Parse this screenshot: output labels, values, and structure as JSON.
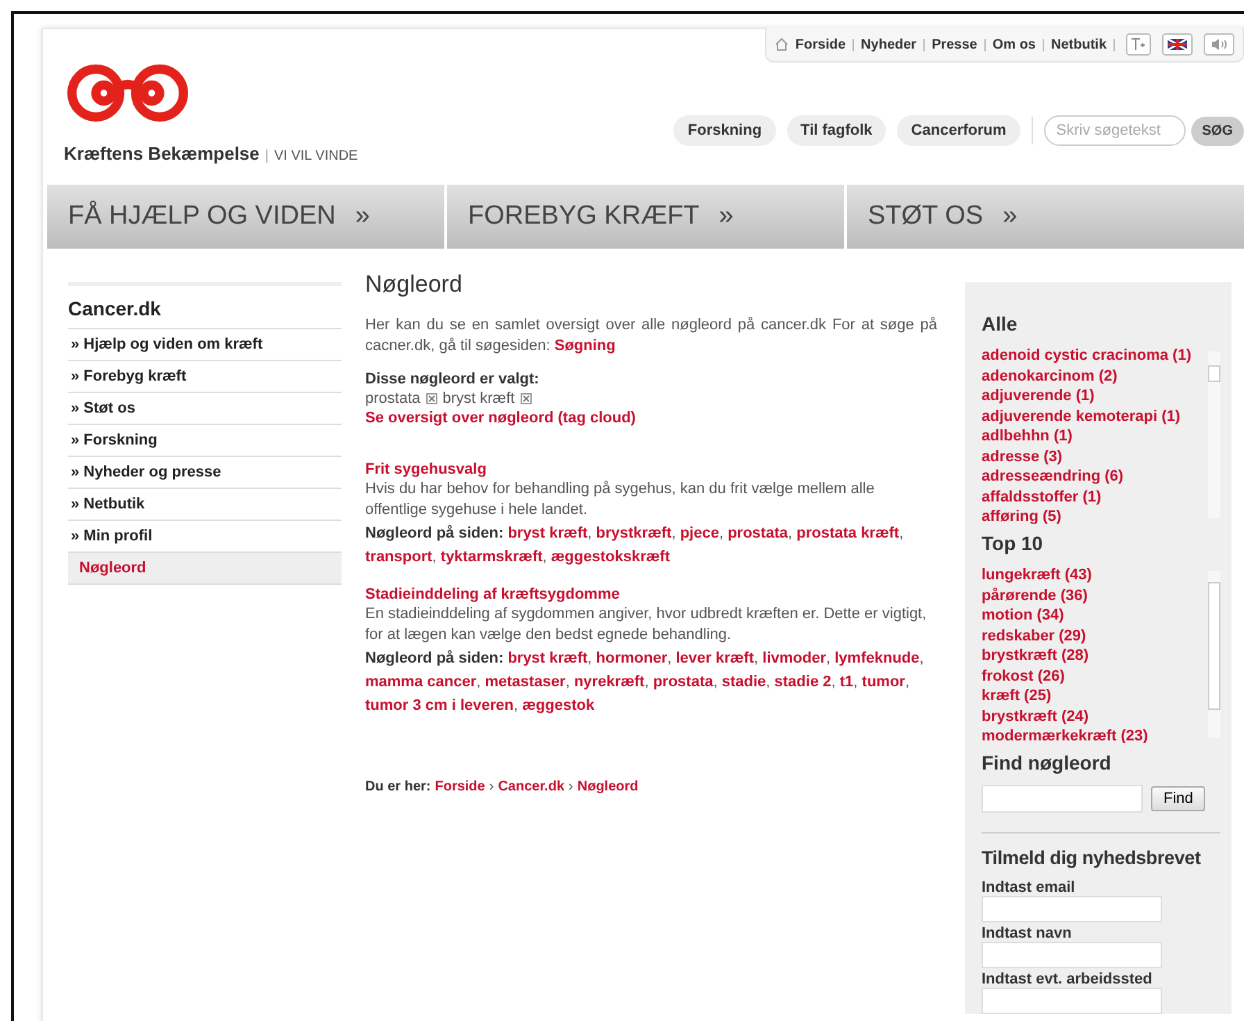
{
  "top_links": [
    "Forside",
    "Nyheder",
    "Presse",
    "Om os",
    "Netbutik"
  ],
  "brand": {
    "name": "Kræftens Bekæmpelse",
    "separator": "|",
    "tagline": "VI VIL VINDE"
  },
  "quick_links": [
    "Forskning",
    "Til fagfolk",
    "Cancerforum"
  ],
  "search": {
    "placeholder": "Skriv søgetekst",
    "button": "SØG"
  },
  "main_nav": [
    {
      "label": "FÅ HJÆLP OG VIDEN",
      "arrow": "»"
    },
    {
      "label": "FOREBYG KRÆFT",
      "arrow": "»"
    },
    {
      "label": "STØT OS",
      "arrow": "»"
    }
  ],
  "sidebar": {
    "title": "Cancer.dk",
    "items": [
      {
        "label": "» Hjælp og viden om kræft",
        "selected": false
      },
      {
        "label": "» Forebyg kræft",
        "selected": false
      },
      {
        "label": "» Støt os",
        "selected": false
      },
      {
        "label": "» Forskning",
        "selected": false
      },
      {
        "label": "» Nyheder og presse",
        "selected": false
      },
      {
        "label": "» Netbutik",
        "selected": false
      },
      {
        "label": "» Min profil",
        "selected": false
      },
      {
        "label": "Nøgleord",
        "selected": true
      }
    ]
  },
  "content": {
    "title": "Nøgleord",
    "intro": "Her kan du se en samlet oversigt over alle nøgleord på cancer.dk  For at søge på cacner.dk, gå til søgesiden:",
    "intro_link": "Søgning",
    "selected_label": "Disse nøgleord er valgt:",
    "selected_tags": [
      "prostata",
      "bryst kræft"
    ],
    "tag_cloud_link": "Se oversigt over nøgleord (tag cloud)",
    "results": [
      {
        "title": "Frit sygehusvalg",
        "description": "Hvis du har behov for behandling på sygehus, kan du frit vælge mellem alle offentlige sygehuse i hele landet.",
        "keywords_label": "Nøgleord på siden:",
        "separator": ",",
        "keywords": [
          "bryst kræft",
          "brystkræft",
          "pjece",
          "prostata",
          "prostata kræft",
          "transport",
          "tyktarmskræft",
          "æggestokskræft"
        ]
      },
      {
        "title": "Stadieinddeling af kræftsygdomme",
        "description": "En stadieinddeling af sygdommen angiver, hvor udbredt kræften er. Dette er vigtigt, for at lægen kan vælge den bedst   egnede behandling.",
        "keywords_label": "Nøgleord på siden:",
        "separator": ",",
        "keywords": [
          "bryst kræft",
          "hormoner",
          "lever kræft",
          "livmoder",
          "lymfeknude",
          "mamma cancer",
          "metastaser",
          "nyrekræft",
          "prostata",
          "stadie",
          "stadie 2",
          "t1",
          "tumor",
          "tumor 3 cm i leveren",
          "æggestok"
        ]
      }
    ],
    "breadcrumb": {
      "label": "Du er her:",
      "items": [
        "Forside",
        "Cancer.dk",
        "Nøgleord"
      ],
      "separator": "›"
    }
  },
  "right": {
    "all_title": "Alle",
    "all": [
      "adenoid cystic cracinoma (1)",
      "adenokarcinom (2)",
      "adjuverende (1)",
      "adjuverende kemoterapi (1)",
      "adlbehhn (1)",
      "adresse (3)",
      "adresseændring (6)",
      "affaldsstoffer (1)",
      "afføring (5)"
    ],
    "top_title": "Top 10",
    "top": [
      "lungekræft (43)",
      "pårørende (36)",
      "motion (34)",
      "redskaber (29)",
      "brystkræft (28)",
      "frokost (26)",
      "kræft (25)",
      "brystkræft (24)",
      "modermærkekræft (23)"
    ],
    "find_title": "Find nøgleord",
    "find_button": "Find",
    "newsletter_title": "Tilmeld dig nyhedsbrevet",
    "newsletter_fields": [
      "Indtast email",
      "Indtast navn",
      "Indtast evt. arbeidssted"
    ]
  }
}
